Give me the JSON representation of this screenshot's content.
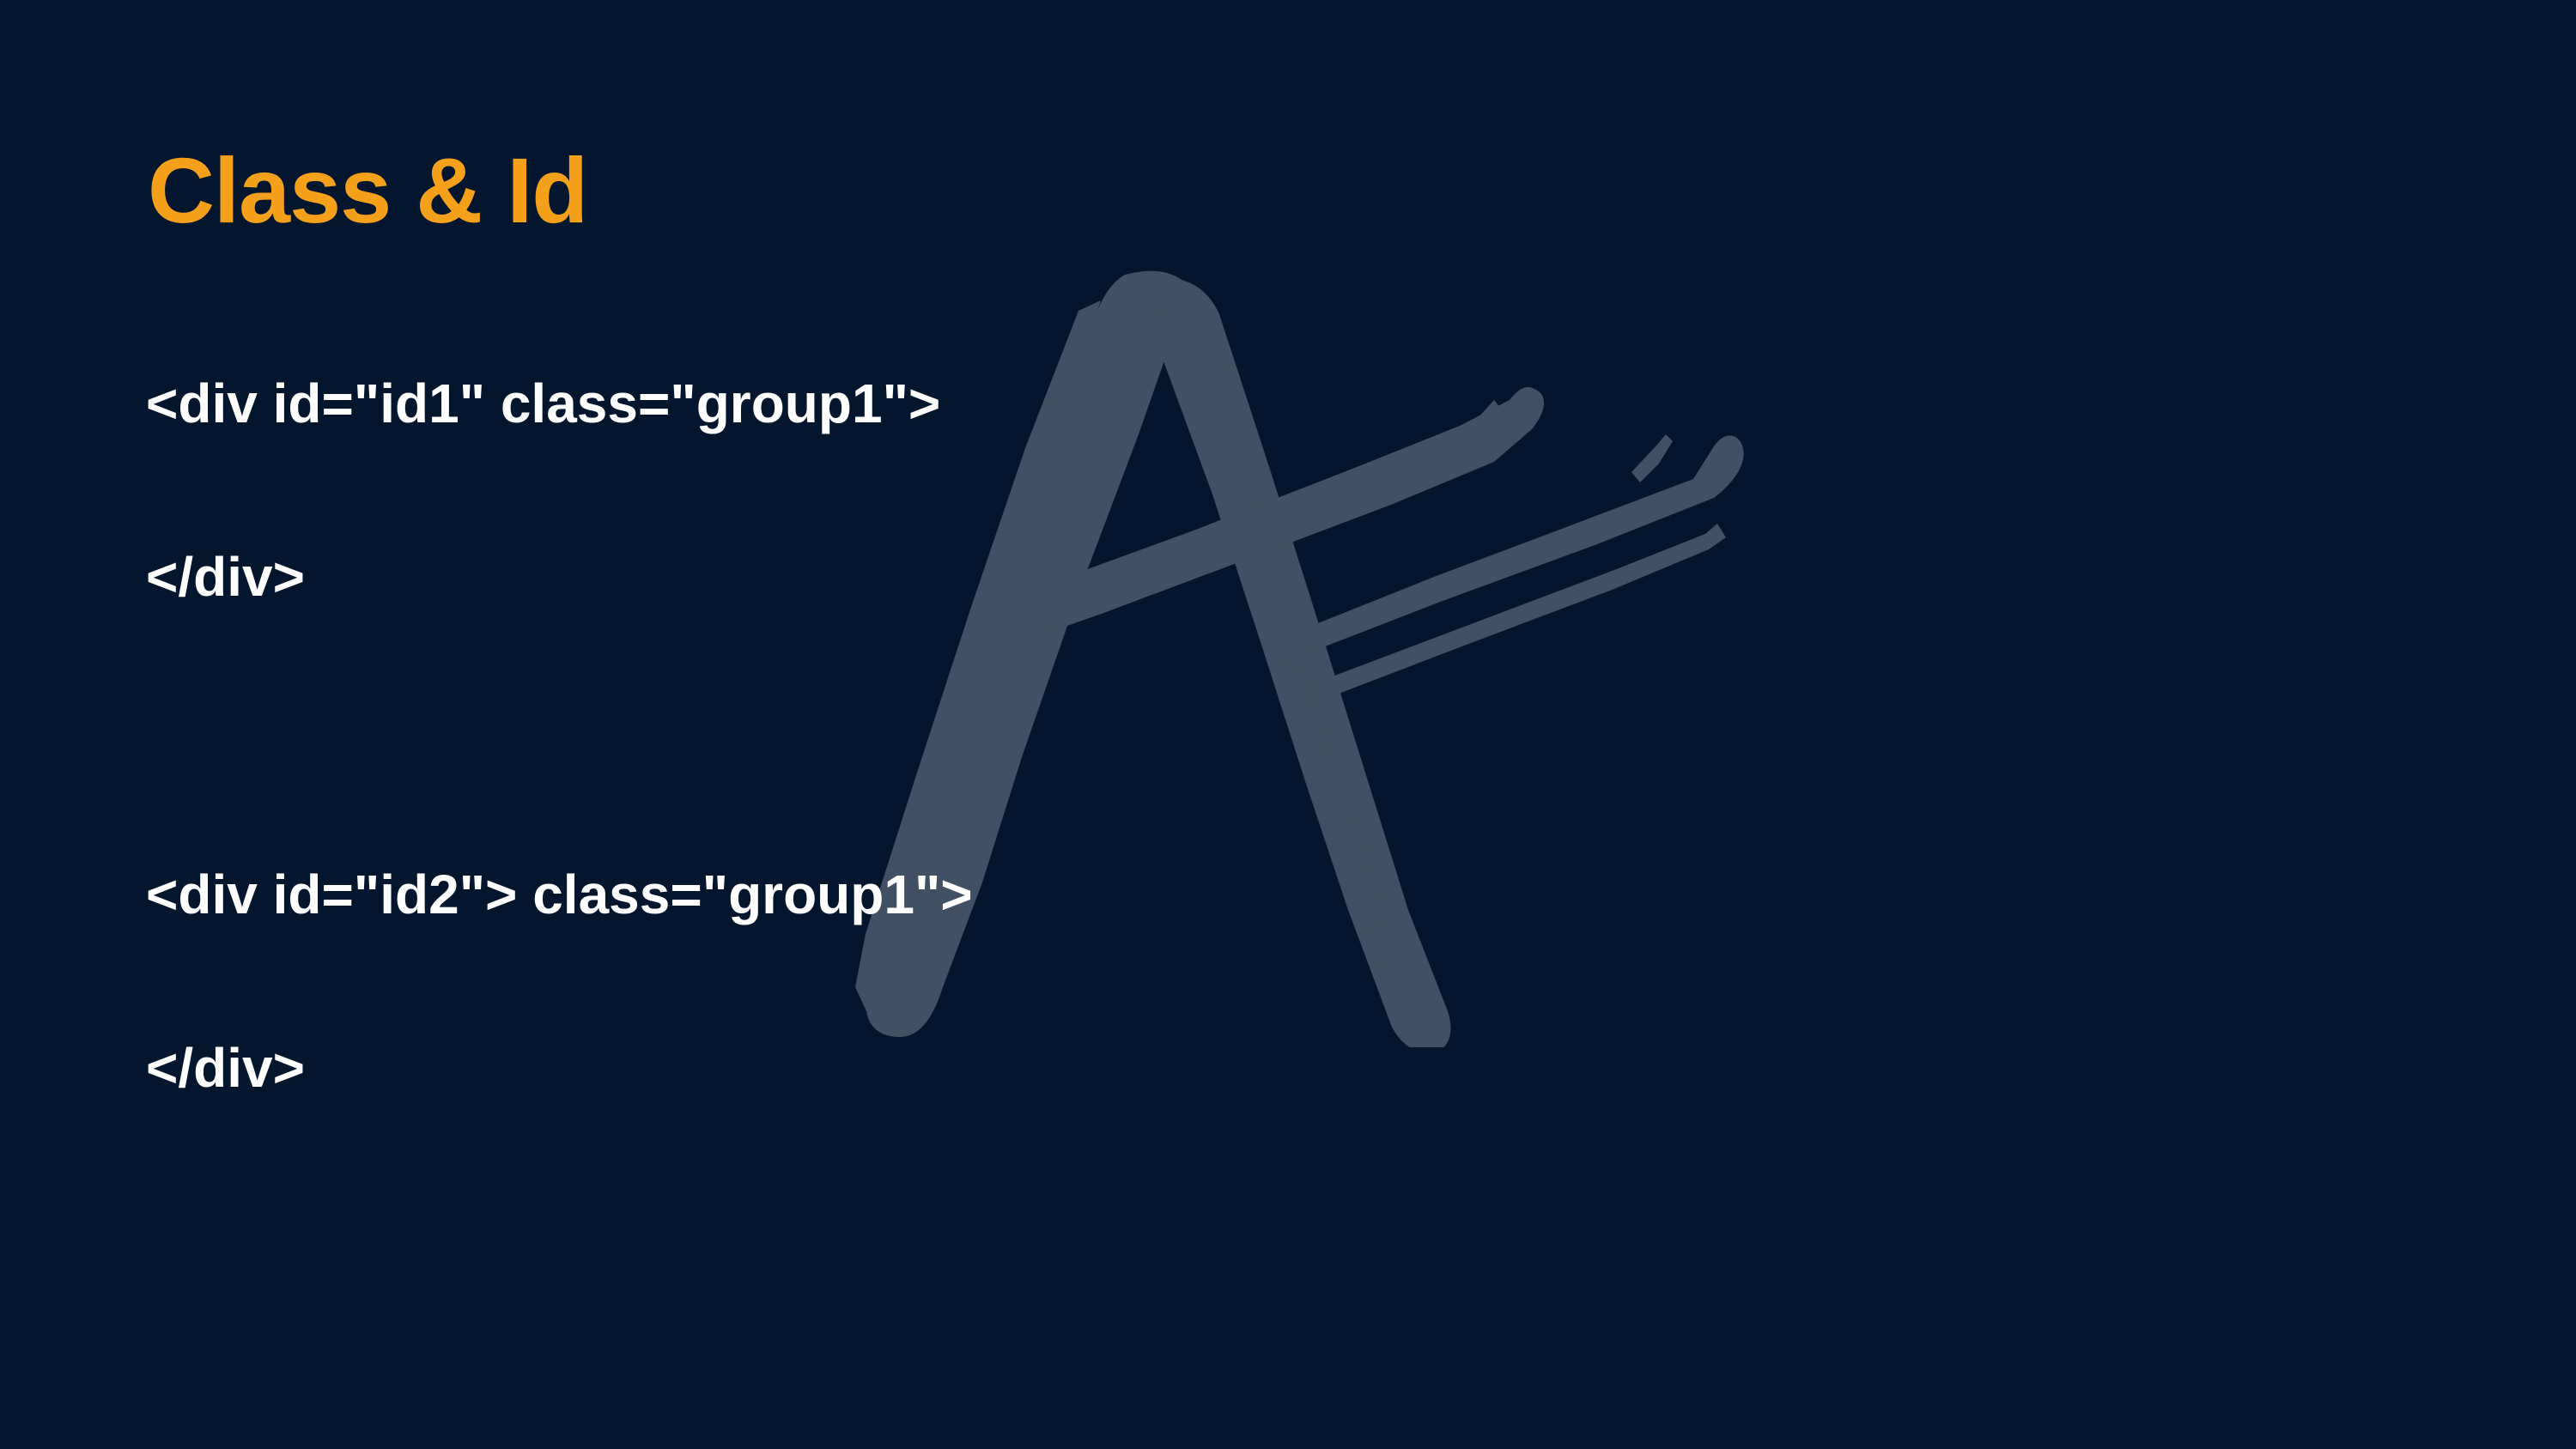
{
  "slide": {
    "title": "Class & Id",
    "code_lines": [
      "<div id=\"id1\" class=\"group1\">",
      "</div>",
      "<div id=\"id2\"> class=\"group1\">",
      "</div>"
    ],
    "logo": {
      "icon": "brush-a-logo-icon",
      "color": "#455467"
    }
  },
  "colors": {
    "background": "#04162d",
    "title": "#f5a01a",
    "text": "#ffffff"
  }
}
